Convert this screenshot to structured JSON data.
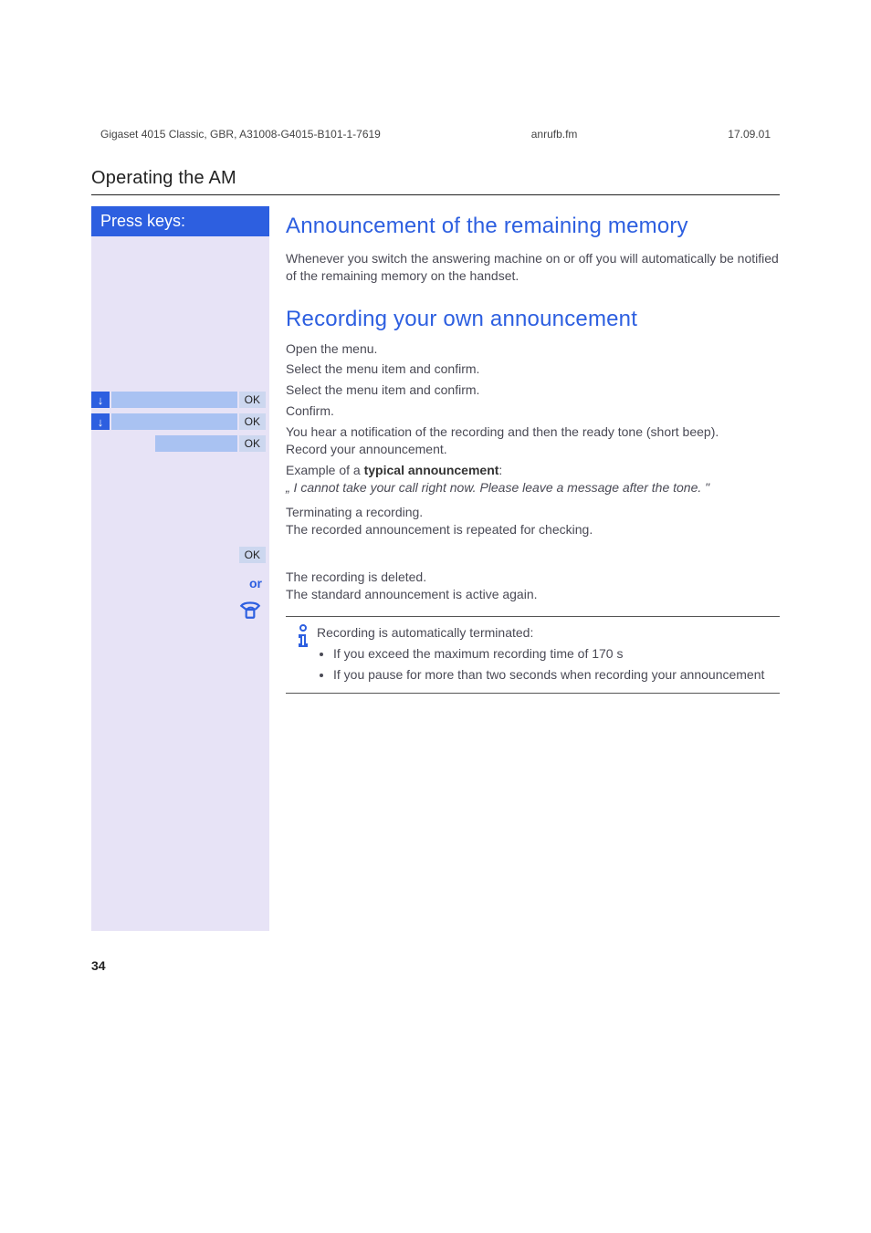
{
  "header": {
    "doc_id": "Gigaset 4015 Classic, GBR, A31008-G4015-B101-1-7619",
    "filename": "anrufb.fm",
    "date": "17.09.01"
  },
  "section_title": "Operating the AM",
  "sidebar": {
    "header": "Press keys:",
    "keys": {
      "arrow": "↓",
      "ok": "OK",
      "or": "or",
      "onhook": "☎"
    }
  },
  "content": {
    "h2_a": "Announcement of the remaining memory",
    "para_a": "Whenever you switch the answering machine on or off you will automatically be notified of the remaining memory on the handset.",
    "h2_b": "Recording your own announcement",
    "open_menu": "Open the menu.",
    "step1": "Select the menu item and confirm.",
    "step2": "Select the menu item and confirm.",
    "step3": "Confirm.",
    "after_confirm": "You hear a notification of the recording and then the ready tone (short beep).\nRecord your announcement.",
    "example_label": "Example of a ",
    "example_bold": "typical announcement",
    "example_colon": ":",
    "example_text": "„ I cannot take your call right now. Please leave a message after the tone. \"",
    "terminate": "Terminating a recording.\nThe recorded announcement is repeated for checking.",
    "deleted": "The recording is deleted.\nThe standard announcement is active again.",
    "info_intro": "Recording is automatically terminated:",
    "info_li1": "If you exceed the maximum recording time of 170 s",
    "info_li2": "If you pause for more than two seconds when recording your announcement"
  },
  "page_number": "34"
}
